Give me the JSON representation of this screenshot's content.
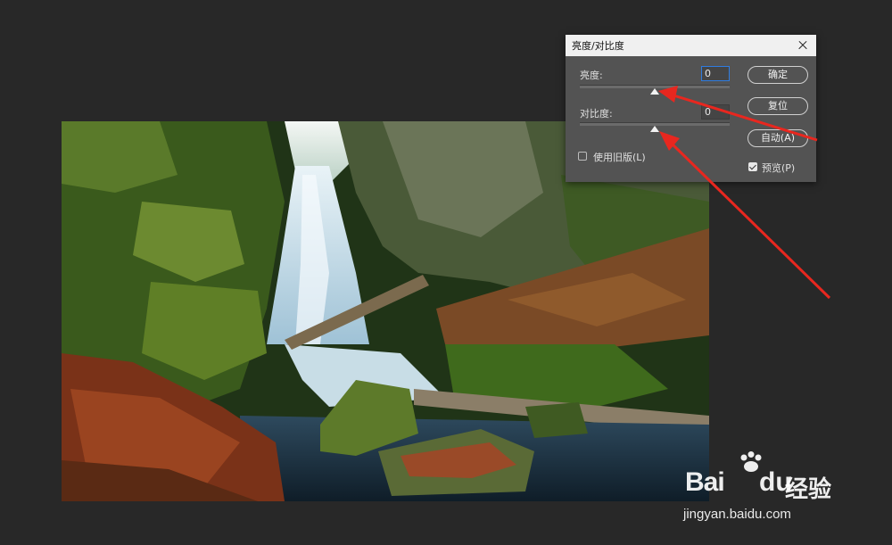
{
  "dialog": {
    "title": "亮度/对比度",
    "brightness": {
      "label": "亮度:",
      "value": "0",
      "slider_level": 0.5
    },
    "contrast": {
      "label": "对比度:",
      "value": "0",
      "slider_level": 0.5
    },
    "legacy_label": "使用旧版(L)",
    "legacy_checked": false,
    "preview_label": "预览(P)",
    "preview_checked": true,
    "buttons": {
      "ok": "确定",
      "reset": "复位",
      "auto": "自动(A)"
    }
  },
  "watermark": {
    "logo_bai": "Bai",
    "logo_du": "du",
    "logo_jy": "经验",
    "url": "jingyan.baidu.com"
  },
  "colors": {
    "workspace": "#282828",
    "dialog_bg": "#535353",
    "titlebar_bg": "#f0f0f0",
    "focus_border": "#2f7ce0",
    "arrow": "#e8271f"
  }
}
